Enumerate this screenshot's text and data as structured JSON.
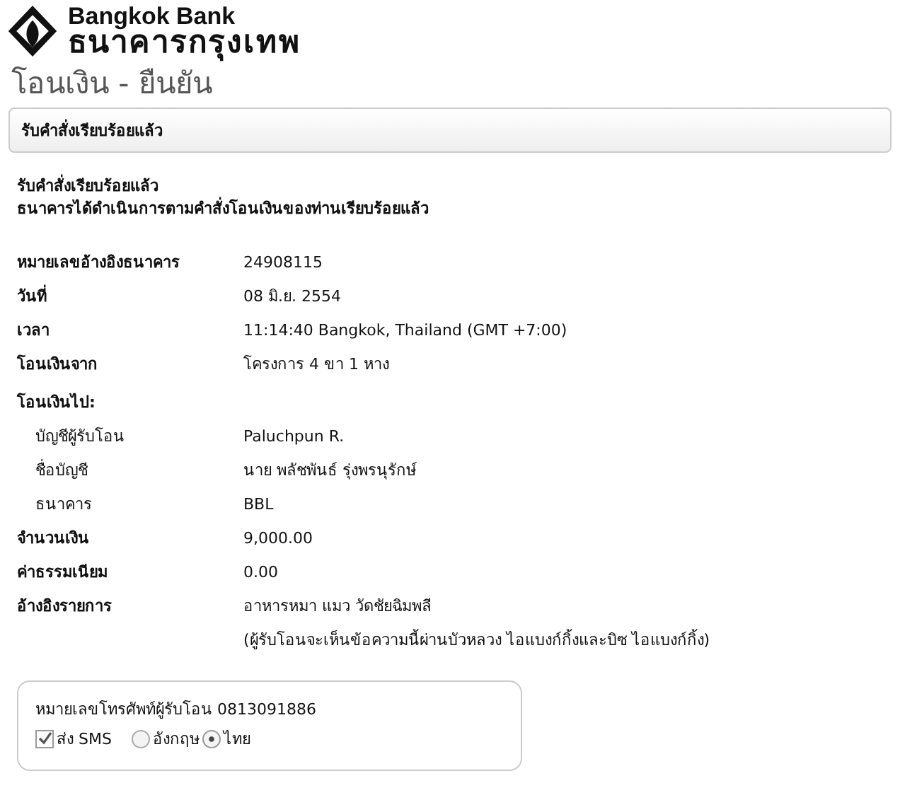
{
  "logo": {
    "brand": "Bangkok Bank",
    "brand_thai": "ธนาคารกรุงเทพ"
  },
  "page_title": "โอนเงิน - ยืนยัน",
  "status_bar": {
    "text": "รับคำสั่งเรียบร้อยแล้ว"
  },
  "message": [
    "รับคำสั่งเรียบร้อยแล้ว",
    "ธนาคารได้ดำเนินการตามคำสั่งโอนเงินของท่านเรียบร้อยแล้ว"
  ],
  "details": [
    {
      "kind": "main",
      "label": "หมายเลขอ้างอิงธนาคาร",
      "values": [
        "24908115"
      ]
    },
    {
      "kind": "main",
      "label": "วันที่",
      "values": [
        "08 มิ.ย. 2554"
      ]
    },
    {
      "kind": "main",
      "label": "เวลา",
      "values": [
        "11:14:40 Bangkok, Thailand (GMT +7:00)"
      ]
    },
    {
      "kind": "main",
      "label": "โอนเงินจาก",
      "values": [
        "โครงการ 4 ขา 1 หาง"
      ]
    },
    {
      "kind": "heading",
      "label": "โอนเงินไป:"
    },
    {
      "kind": "sub",
      "label": "บัญชีผู้รับโอน",
      "values": [
        "Paluchpun R."
      ]
    },
    {
      "kind": "sub",
      "label": "ชื่อบัญชี",
      "values": [
        "นาย พลัชพันธ์ รุ่งพรนุรักษ์"
      ]
    },
    {
      "kind": "sub",
      "label": "ธนาคาร",
      "values": [
        "BBL"
      ]
    },
    {
      "kind": "main",
      "label": "จำนวนเงิน",
      "values": [
        "9,000.00"
      ]
    },
    {
      "kind": "main",
      "label": "ค่าธรรมเนียม",
      "values": [
        "0.00"
      ]
    },
    {
      "kind": "main",
      "label": "อ้างอิงรายการ",
      "values": [
        "อาหารหมา แมว วัดชัยฉิมพลี",
        "(ผู้รับโอนจะเห็นข้อความนี้ผ่านบัวหลวง ไอแบงก์กิ้งและบิซ ไอแบงก์กิ้ง)"
      ]
    }
  ],
  "sms": {
    "phone_label": "หมายเลขโทรศัพท์ผู้รับโอน 0813091886",
    "send_sms": {
      "label": "ส่ง SMS",
      "checked": true
    },
    "languages": [
      {
        "label": "อังกฤษ",
        "selected": false
      },
      {
        "label": "ไทย",
        "selected": true
      }
    ]
  }
}
